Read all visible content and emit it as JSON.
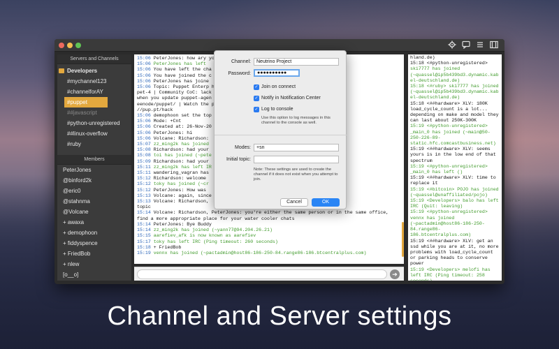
{
  "colors": {
    "accent": "#e3a83e",
    "ok_button": "#2a85f5",
    "join_text": "#3f9a2a",
    "timestamp": "#2a64b8"
  },
  "caption": "Channel and Server settings",
  "toolbar": {
    "icons": [
      "gear-icon",
      "chat-bubble-icon",
      "list-icon",
      "split-view-icon"
    ]
  },
  "sidebar": {
    "servers_header": "Servers and Channels",
    "server_name": "Developers",
    "channels": [
      "#mychannel123",
      "#channelforAY",
      "#puppet",
      "##javascript",
      "#python-unregistered",
      "##linux-overflow",
      "#ruby"
    ],
    "selected_channel": "#puppet",
    "members_header": "Members",
    "members": [
      "PeterJones",
      "@binford2k",
      "@eric0",
      "@stahnma",
      "@Volcane",
      "+ awaxa",
      "+ demophoon",
      "+ fiddyspence",
      "+ FriedBob",
      "+ nlew",
      "[o__o]"
    ]
  },
  "chat": {
    "lines": [
      {
        "ts": "15:06",
        "text": "PeterJones: how ary you"
      },
      {
        "ts": "15:06",
        "text": "PeterJones has left"
      },
      {
        "ts": "15:06",
        "text": "You have left the cha"
      },
      {
        "ts": "15:06",
        "text": "You have joined the c"
      },
      {
        "ts": "15:06",
        "text": "PeterJones has joine"
      },
      {
        "ts": "15:06",
        "text": "Topic: Puppet Enterp                                http://pup.pt/puppe"
      },
      {
        "ts": "",
        "text": "pet-4 | Community CoC:                         lack | Key errors"
      },
      {
        "ts": "",
        "text": "when you update puppet-agen                   https://botbot.me/fr"
      },
      {
        "ts": "",
        "text": "eenode/puppet/ | Watch the                    ppetHack 2017 http:"
      },
      {
        "ts": "",
        "text": "//pup.pt/hack"
      },
      {
        "ts": "15:06",
        "text": "demophoon set the top"
      },
      {
        "ts": "15:06",
        "text": "Mode: +Cnt"
      },
      {
        "ts": "15:06",
        "text": "Created at: 26-Nov-20"
      },
      {
        "ts": "15:06",
        "text": "PeterJones: hi"
      },
      {
        "ts": "15:06",
        "text": "Volcane: Richardson:"
      },
      {
        "ts": "15:07",
        "text": "zz_ming2k has joined"
      },
      {
        "ts": "15:08",
        "text": "Richardson: had your"
      },
      {
        "ts": "15:08",
        "text": "toi has joined (~pete"
      },
      {
        "ts": "15:09",
        "text": "Richardson: had your"
      },
      {
        "ts": "15:11",
        "text": "zz_ming2k has left IR"
      },
      {
        "ts": "15:11",
        "text": "wandering_vagran has"
      },
      {
        "ts": "15:12",
        "text": "Richardson: welcome"
      },
      {
        "ts": "15:12",
        "text": "toky has joined (~cr"
      },
      {
        "ts": "15:12",
        "text": "PeterJones: How was"
      },
      {
        "ts": "15:13",
        "text": "Volcane: again, since                      e, please stay on"
      },
      {
        "ts": "15:13",
        "text": "Volcane: Richardson,"
      },
      {
        "ts": "",
        "text": "topic"
      },
      {
        "ts": "15:14",
        "text": "Volcane: Richardson, PeterJones: you're either the same person or in the same office,"
      },
      {
        "ts": "",
        "text": "find a more appropriate place for your water cooler chats"
      },
      {
        "ts": "15:14",
        "text": "PeterJones: Bye Buddy"
      },
      {
        "ts": "15:14",
        "text": "zz_ming2k has joined (~yann77@94.204.26.21)"
      },
      {
        "ts": "15:15",
        "text": "aarefiev_afk is now known as aarefiev"
      },
      {
        "ts": "15:17",
        "text": "toky has left IRC (Ping timeout: 260 seconds)"
      },
      {
        "ts": "15:18",
        "text": "+ FriedBob"
      },
      {
        "ts": "15:19",
        "text": "vennx has joined (~pactadmin@host86-186-250-84.range86-186.btcentralplus.com)"
      }
    ]
  },
  "right": {
    "lines": [
      "hland.de)",
      "15:18 <#python-unregistered>",
      "ski7777 has joined (~quassel@ip5b439bd3.dynamic.kabel-deutschland.de)",
      "15:18 <#ruby> ski7777 has joined (~quassel@ip5b439bd3.dynamic.kabel-deutschland.de)",
      "15:18 <##hardware> XLV: 180K load_cycle_count is a lot... depending on make and model they can last about 250K-300K",
      "15:19 <#python-unregistered> _main_0 has joined (~main@50-250-226-89-static.hfc.comcastbusiness.net)",
      "15:19 <##hardware> XLV: seems yours is in the low end of that spectrum",
      "15:19 <#python-unregistered> _main_0 has left ()",
      "15:19 <##hardware> XLV: time to replace it",
      "15:19 <#bitcoin> POJO has joined (~quassel@unaffiliated/pojo)",
      "15:19 <Developers> balo has left IRC (Quit: leaving)",
      "15:19 <#python-unregistered> vennx has joined (~pactadmin@host86-186-250-84.range86-186.btcentralplus.com)",
      "15:19 <##hardware> XLV: get an ssd while you are at it, no more problems with load_cycle_count or parking heads to conserve power",
      "15:19 <Developers> melofi has left IRC (Ping timeout: 258 seconds)"
    ]
  },
  "dialog": {
    "channel_label": "Channel:",
    "channel_value": "Neutrino Project",
    "password_label": "Password:",
    "password_value": "●●●●●●●●●●",
    "join_on_connect": "Join on connect",
    "notify": "Notify in Notification Center",
    "log_console": "Log to console",
    "log_hint": "Use this option to log messages in this channel to the console as well.",
    "modes_label": "Modes:",
    "modes_value": "+sn",
    "topic_label": "Initial topic:",
    "topic_value": "",
    "settings_note": "Note: These settings are used to create the channel if it does not exist when you attempt to join.",
    "cancel": "Cancel",
    "ok": "OK"
  }
}
